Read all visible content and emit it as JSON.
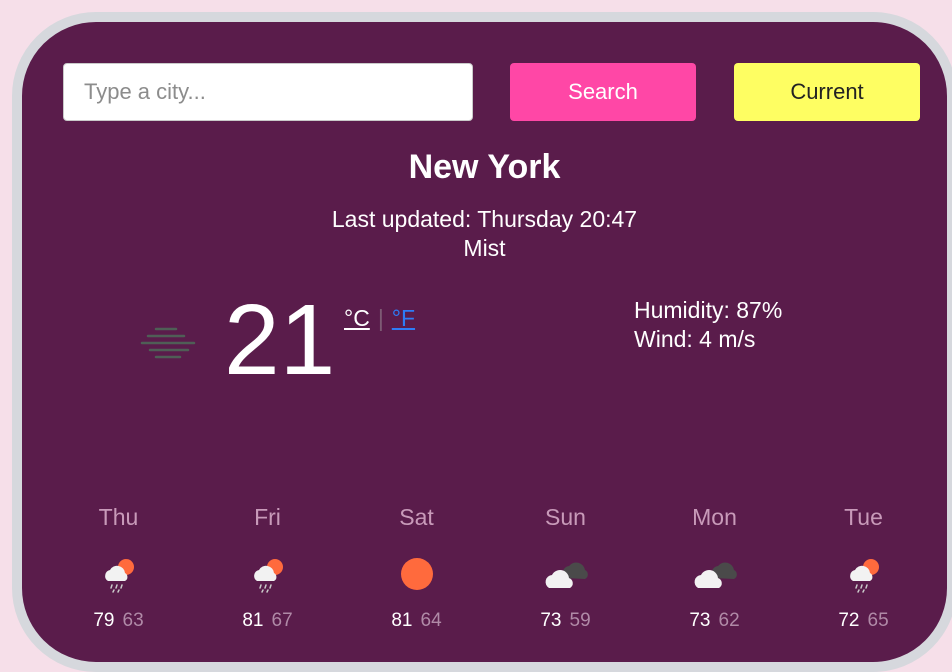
{
  "search": {
    "placeholder": "Type a city...",
    "search_label": "Search",
    "current_label": "Current"
  },
  "weather": {
    "city": "New York",
    "last_updated": "Last updated: Thursday 20:47",
    "description": "Mist",
    "icon": "mist-icon",
    "temperature": "21",
    "unit_celsius": "°C",
    "unit_separator": "|",
    "unit_fahrenheit": "°F",
    "humidity": "Humidity: 87%",
    "wind": "Wind: 4 m/s"
  },
  "forecast": [
    {
      "day": "Thu",
      "icon": "sun-cloud-rain-icon",
      "max": "79",
      "min": "63"
    },
    {
      "day": "Fri",
      "icon": "sun-cloud-rain-icon",
      "max": "81",
      "min": "67"
    },
    {
      "day": "Sat",
      "icon": "sun-icon",
      "max": "81",
      "min": "64"
    },
    {
      "day": "Sun",
      "icon": "cloudy-icon",
      "max": "73",
      "min": "59"
    },
    {
      "day": "Mon",
      "icon": "cloudy-icon",
      "max": "73",
      "min": "62"
    },
    {
      "day": "Tue",
      "icon": "sun-cloud-rain-icon",
      "max": "72",
      "min": "65"
    }
  ],
  "colors": {
    "page_bg": "#f6dfe9",
    "card_bg": "#5a1c4b",
    "search_button": "#ff47a6",
    "current_button": "#fefe62",
    "link_blue": "#2e7cf6"
  }
}
